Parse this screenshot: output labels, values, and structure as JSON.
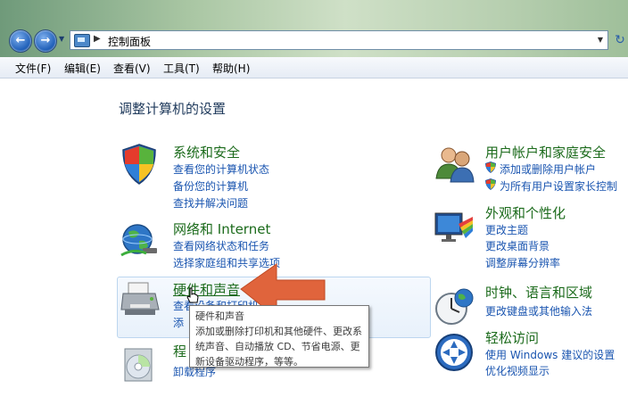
{
  "address_bar": {
    "path_label": "控制面板"
  },
  "menu": [
    "文件(F)",
    "编辑(E)",
    "查看(V)",
    "工具(T)",
    "帮助(H)"
  ],
  "page_title": "调整计算机的设置",
  "categories": [
    {
      "title": "系统和安全",
      "links": [
        "查看您的计算机状态",
        "备份您的计算机",
        "查找并解决问题"
      ]
    },
    {
      "title": "网络和 Internet",
      "links": [
        "查看网络状态和任务",
        "选择家庭组和共享选项"
      ]
    },
    {
      "title": "硬件和声音",
      "links": [
        "查看设备和打印机",
        "添"
      ]
    },
    {
      "title": "程",
      "links": [
        "卸载程序"
      ]
    },
    {
      "title": "用户帐户和家庭安全",
      "links": [
        "添加或删除用户帐户",
        "为所有用户设置家长控制"
      ]
    },
    {
      "title": "外观和个性化",
      "links": [
        "更改主题",
        "更改桌面背景",
        "调整屏幕分辨率"
      ]
    },
    {
      "title": "时钟、语言和区域",
      "links": [
        "更改键盘或其他输入法"
      ]
    },
    {
      "title": "轻松访问",
      "links": [
        "使用 Windows 建议的设置",
        "优化视频显示"
      ]
    }
  ],
  "tooltip": {
    "title": "硬件和声音",
    "body": "添加或删除打印机和其他硬件、更改系统声音、自动播放 CD、节省电源、更新设备驱动程序，等等。"
  },
  "colors": {
    "category_title": "#1c6b1c",
    "link": "#1a55b0",
    "annotation_arrow": "#e0643c"
  },
  "icons": [
    "back-arrow-icon",
    "forward-arrow-icon",
    "control-panel-icon",
    "refresh-icon",
    "shield-icon",
    "users-icon",
    "network-globe-icon",
    "appearance-icon",
    "printer-icon",
    "clock-icon",
    "programs-disc-icon",
    "ease-of-access-icon",
    "hand-cursor-icon"
  ]
}
